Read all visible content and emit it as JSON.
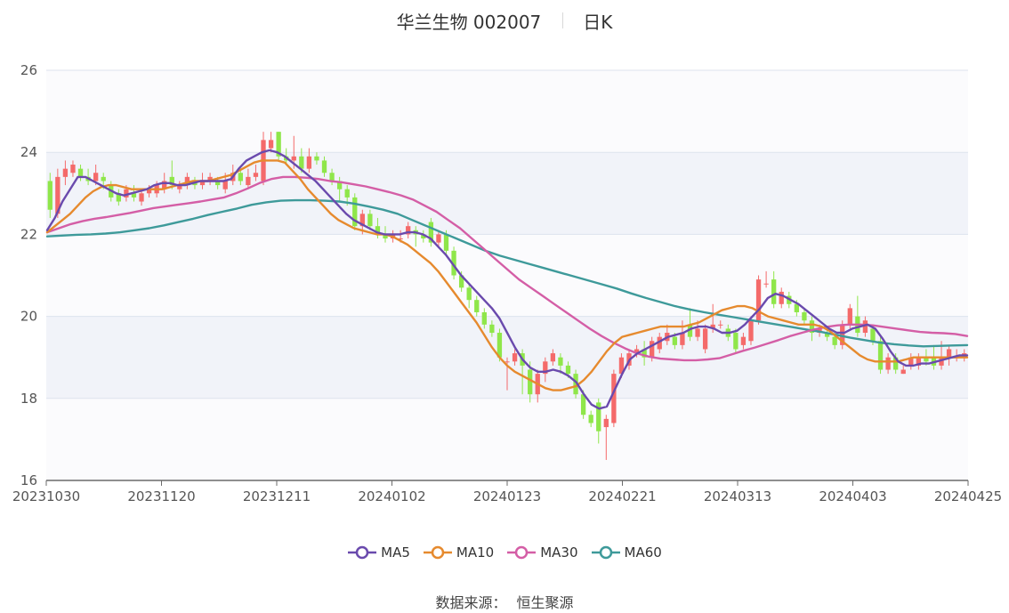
{
  "header": {
    "title": "华兰生物 002007",
    "period": "日K"
  },
  "legend": [
    {
      "label": "MA5",
      "color": "#6a4aad"
    },
    {
      "label": "MA10",
      "color": "#e68a2e"
    },
    {
      "label": "MA30",
      "color": "#d45ea6"
    },
    {
      "label": "MA60",
      "color": "#3e9a9a"
    }
  ],
  "footer": {
    "source_label": "数据来源：",
    "source_value": "恒生聚源"
  },
  "chart_data": {
    "type": "candlestick",
    "title": "华兰生物 002007",
    "ylim": [
      16,
      26
    ],
    "y_ticks": [
      "16",
      "18",
      "20",
      "22",
      "24",
      "26"
    ],
    "x_ticks": [
      "20231030",
      "20231120",
      "20231211",
      "20240102",
      "20240123",
      "20240221",
      "20240313",
      "20240403",
      "20240425"
    ],
    "colors": {
      "up": "#f46a6a",
      "down": "#8fe64a",
      "ma5": "#6a4aad",
      "ma10": "#e68a2e",
      "ma30": "#d45ea6",
      "ma60": "#3e9a9a"
    },
    "candles": [
      [
        23.3,
        22.6,
        23.5,
        22.4
      ],
      [
        22.5,
        23.4,
        23.6,
        22.4
      ],
      [
        23.4,
        23.6,
        23.8,
        23.2
      ],
      [
        23.5,
        23.7,
        23.8,
        23.4
      ],
      [
        23.6,
        23.4,
        23.7,
        23.3
      ],
      [
        23.4,
        23.3,
        23.6,
        23.2
      ],
      [
        23.3,
        23.5,
        23.7,
        23.2
      ],
      [
        23.4,
        23.3,
        23.5,
        23.1
      ],
      [
        23.2,
        22.9,
        23.3,
        22.8
      ],
      [
        23.0,
        22.8,
        23.1,
        22.7
      ],
      [
        22.9,
        23.1,
        23.2,
        22.8
      ],
      [
        23.0,
        22.9,
        23.2,
        22.8
      ],
      [
        22.8,
        23.0,
        23.1,
        22.7
      ],
      [
        23.0,
        23.1,
        23.2,
        22.9
      ],
      [
        23.0,
        23.2,
        23.3,
        22.9
      ],
      [
        23.1,
        23.3,
        23.5,
        23.0
      ],
      [
        23.4,
        23.2,
        23.8,
        23.1
      ],
      [
        23.1,
        23.2,
        23.3,
        23.0
      ],
      [
        23.2,
        23.4,
        23.5,
        23.1
      ],
      [
        23.3,
        23.2,
        23.4,
        23.1
      ],
      [
        23.2,
        23.3,
        23.5,
        23.1
      ],
      [
        23.3,
        23.4,
        23.5,
        23.2
      ],
      [
        23.3,
        23.2,
        23.4,
        23.1
      ],
      [
        23.1,
        23.3,
        23.5,
        23.0
      ],
      [
        23.3,
        23.5,
        23.7,
        23.2
      ],
      [
        23.5,
        23.3,
        23.6,
        23.2
      ],
      [
        23.2,
        23.4,
        23.6,
        23.1
      ],
      [
        23.4,
        23.5,
        23.7,
        23.3
      ],
      [
        23.3,
        24.3,
        24.5,
        23.2
      ],
      [
        24.1,
        24.3,
        24.5,
        24.0
      ],
      [
        24.5,
        23.9,
        24.5,
        23.8
      ],
      [
        23.9,
        23.8,
        24.1,
        23.7
      ],
      [
        23.8,
        23.9,
        24.4,
        23.6
      ],
      [
        23.9,
        23.6,
        24.1,
        23.5
      ],
      [
        23.6,
        23.9,
        24.1,
        23.5
      ],
      [
        23.9,
        23.8,
        24.0,
        23.7
      ],
      [
        23.8,
        23.5,
        23.9,
        23.4
      ],
      [
        23.5,
        23.3,
        23.6,
        23.2
      ],
      [
        23.3,
        23.1,
        23.4,
        22.8
      ],
      [
        23.1,
        22.9,
        23.2,
        22.7
      ],
      [
        22.9,
        22.2,
        23.0,
        22.1
      ],
      [
        22.2,
        22.5,
        22.6,
        22.0
      ],
      [
        22.5,
        22.2,
        22.6,
        22.1
      ],
      [
        22.2,
        22.0,
        22.4,
        21.9
      ],
      [
        22.0,
        21.9,
        22.2,
        21.8
      ],
      [
        21.9,
        22.0,
        22.1,
        21.8
      ],
      [
        21.9,
        21.9,
        22.1,
        21.8
      ],
      [
        22.0,
        22.2,
        22.3,
        21.9
      ],
      [
        22.1,
        22.0,
        22.2,
        21.7
      ],
      [
        22.0,
        21.9,
        22.1,
        21.8
      ],
      [
        22.3,
        21.8,
        22.4,
        21.7
      ],
      [
        21.8,
        22.0,
        22.1,
        21.7
      ],
      [
        22.0,
        21.6,
        22.1,
        21.5
      ],
      [
        21.6,
        21.0,
        21.7,
        20.9
      ],
      [
        21.0,
        20.7,
        21.1,
        20.6
      ],
      [
        20.7,
        20.4,
        20.8,
        20.2
      ],
      [
        20.4,
        20.1,
        20.5,
        20.0
      ],
      [
        20.1,
        19.8,
        20.2,
        19.7
      ],
      [
        19.8,
        19.6,
        19.9,
        19.5
      ],
      [
        19.6,
        19.0,
        19.7,
        18.9
      ],
      [
        18.9,
        18.9,
        19.0,
        18.2
      ],
      [
        18.9,
        19.1,
        19.2,
        18.8
      ],
      [
        19.1,
        18.8,
        19.2,
        18.1
      ],
      [
        18.7,
        18.1,
        18.9,
        17.9
      ],
      [
        18.1,
        18.6,
        18.7,
        17.9
      ],
      [
        18.6,
        18.9,
        19.0,
        18.4
      ],
      [
        18.9,
        19.1,
        19.2,
        18.8
      ],
      [
        19.0,
        18.8,
        19.1,
        18.6
      ],
      [
        18.8,
        18.6,
        18.9,
        18.5
      ],
      [
        18.6,
        18.1,
        18.7,
        18.0
      ],
      [
        18.1,
        17.6,
        18.2,
        17.5
      ],
      [
        17.6,
        17.4,
        17.7,
        17.3
      ],
      [
        17.9,
        17.2,
        18.0,
        16.9
      ],
      [
        17.3,
        17.5,
        17.6,
        16.5
      ],
      [
        17.4,
        18.6,
        18.7,
        17.3
      ],
      [
        18.6,
        19.0,
        19.1,
        18.5
      ],
      [
        18.8,
        19.1,
        19.2,
        18.7
      ],
      [
        19.1,
        19.2,
        19.3,
        19.0
      ],
      [
        19.2,
        19.0,
        19.4,
        18.8
      ],
      [
        19.0,
        19.4,
        19.5,
        18.9
      ],
      [
        19.2,
        19.5,
        19.6,
        19.1
      ],
      [
        19.4,
        19.6,
        19.8,
        19.3
      ],
      [
        19.5,
        19.3,
        19.6,
        19.2
      ],
      [
        19.3,
        19.6,
        19.9,
        19.2
      ],
      [
        19.8,
        19.5,
        20.2,
        19.4
      ],
      [
        19.5,
        19.7,
        19.9,
        19.4
      ],
      [
        19.2,
        19.7,
        19.8,
        19.1
      ],
      [
        19.7,
        19.8,
        20.3,
        19.6
      ],
      [
        19.8,
        19.8,
        19.9,
        19.7
      ],
      [
        19.7,
        19.5,
        19.8,
        19.4
      ],
      [
        19.6,
        19.2,
        19.7,
        19.1
      ],
      [
        19.3,
        19.5,
        19.6,
        19.2
      ],
      [
        19.4,
        19.9,
        20.0,
        19.3
      ],
      [
        19.9,
        20.9,
        21.0,
        19.8
      ],
      [
        20.8,
        20.8,
        21.1,
        20.7
      ],
      [
        20.9,
        20.3,
        21.1,
        20.2
      ],
      [
        20.3,
        20.6,
        20.7,
        20.2
      ],
      [
        20.5,
        20.3,
        20.6,
        20.2
      ],
      [
        20.3,
        20.1,
        20.4,
        20.0
      ],
      [
        20.1,
        19.9,
        20.2,
        19.8
      ],
      [
        19.9,
        19.6,
        20.0,
        19.4
      ],
      [
        19.6,
        19.7,
        19.8,
        19.5
      ],
      [
        19.6,
        19.5,
        19.7,
        19.4
      ],
      [
        19.5,
        19.3,
        19.6,
        19.2
      ],
      [
        19.3,
        19.8,
        19.9,
        19.2
      ],
      [
        19.8,
        20.2,
        20.3,
        19.7
      ],
      [
        20.0,
        19.6,
        20.5,
        19.5
      ],
      [
        19.6,
        19.9,
        20.0,
        19.5
      ],
      [
        19.7,
        19.4,
        19.8,
        19.3
      ],
      [
        19.4,
        18.7,
        19.5,
        18.6
      ],
      [
        18.7,
        19.0,
        19.1,
        18.6
      ],
      [
        19.0,
        18.7,
        19.1,
        18.6
      ],
      [
        18.6,
        18.7,
        18.8,
        18.6
      ],
      [
        18.8,
        19.0,
        19.1,
        18.7
      ],
      [
        18.8,
        19.0,
        19.1,
        18.7
      ],
      [
        19.0,
        18.9,
        19.2,
        18.8
      ],
      [
        19.0,
        18.8,
        19.3,
        18.7
      ],
      [
        18.8,
        19.0,
        19.4,
        18.7
      ],
      [
        19.0,
        19.2,
        19.3,
        18.8
      ],
      [
        19.0,
        19.0,
        19.2,
        18.9
      ],
      [
        19.0,
        19.1,
        19.2,
        18.9
      ]
    ],
    "ma5": [
      22.1,
      22.4,
      22.8,
      23.1,
      23.4,
      23.4,
      23.3,
      23.2,
      23.1,
      23.0,
      22.95,
      23.0,
      23.05,
      23.1,
      23.2,
      23.25,
      23.25,
      23.2,
      23.2,
      23.25,
      23.3,
      23.3,
      23.3,
      23.3,
      23.35,
      23.6,
      23.8,
      23.9,
      24.0,
      24.05,
      24.0,
      23.9,
      23.75,
      23.6,
      23.45,
      23.3,
      23.1,
      22.9,
      22.7,
      22.5,
      22.35,
      22.25,
      22.15,
      22.05,
      22.0,
      22.0,
      22.0,
      22.05,
      22.05,
      22.0,
      21.9,
      21.7,
      21.5,
      21.25,
      21.0,
      20.8,
      20.6,
      20.4,
      20.2,
      19.95,
      19.6,
      19.25,
      18.95,
      18.75,
      18.65,
      18.65,
      18.7,
      18.65,
      18.55,
      18.4,
      18.1,
      17.85,
      17.75,
      17.8,
      18.2,
      18.6,
      18.95,
      19.1,
      19.2,
      19.3,
      19.4,
      19.5,
      19.55,
      19.6,
      19.7,
      19.75,
      19.75,
      19.7,
      19.6,
      19.6,
      19.65,
      19.8,
      20.0,
      20.2,
      20.45,
      20.55,
      20.5,
      20.4,
      20.3,
      20.15,
      20.0,
      19.85,
      19.7,
      19.6,
      19.6,
      19.7,
      19.75,
      19.8,
      19.7,
      19.45,
      19.15,
      18.9,
      18.8,
      18.8,
      18.85,
      18.85,
      18.9,
      18.95,
      19.0,
      19.05,
      19.05
    ],
    "ma10": [
      22.05,
      22.2,
      22.35,
      22.5,
      22.7,
      22.9,
      23.05,
      23.15,
      23.2,
      23.2,
      23.15,
      23.1,
      23.1,
      23.1,
      23.1,
      23.1,
      23.15,
      23.2,
      23.25,
      23.3,
      23.3,
      23.3,
      23.35,
      23.4,
      23.45,
      23.55,
      23.65,
      23.75,
      23.8,
      23.8,
      23.8,
      23.75,
      23.55,
      23.35,
      23.1,
      22.9,
      22.7,
      22.5,
      22.35,
      22.25,
      22.15,
      22.1,
      22.05,
      22.0,
      22.0,
      21.95,
      21.85,
      21.75,
      21.6,
      21.45,
      21.3,
      21.1,
      20.85,
      20.6,
      20.35,
      20.1,
      19.85,
      19.55,
      19.25,
      19.0,
      18.8,
      18.65,
      18.55,
      18.45,
      18.35,
      18.25,
      18.2,
      18.2,
      18.25,
      18.3,
      18.45,
      18.65,
      18.9,
      19.15,
      19.35,
      19.5,
      19.55,
      19.6,
      19.65,
      19.7,
      19.75,
      19.75,
      19.75,
      19.75,
      19.8,
      19.85,
      19.95,
      20.05,
      20.15,
      20.2,
      20.25,
      20.25,
      20.2,
      20.1,
      20.0,
      19.95,
      19.9,
      19.85,
      19.8,
      19.8,
      19.8,
      19.75,
      19.65,
      19.5,
      19.35,
      19.2,
      19.05,
      18.95,
      18.9,
      18.9,
      18.9,
      18.9,
      18.95,
      19.0,
      19.0,
      19.0,
      19.0,
      19.0,
      19.0,
      19.0,
      19.0
    ],
    "ma30": [
      22.05,
      22.15,
      22.25,
      22.32,
      22.38,
      22.42,
      22.47,
      22.52,
      22.58,
      22.64,
      22.68,
      22.72,
      22.76,
      22.8,
      22.85,
      22.9,
      23.0,
      23.12,
      23.25,
      23.35,
      23.4,
      23.4,
      23.38,
      23.35,
      23.3,
      23.27,
      23.22,
      23.17,
      23.1,
      23.03,
      22.95,
      22.85,
      22.7,
      22.55,
      22.35,
      22.15,
      21.9,
      21.65,
      21.4,
      21.15,
      20.9,
      20.7,
      20.5,
      20.3,
      20.1,
      19.9,
      19.7,
      19.52,
      19.36,
      19.22,
      19.1,
      19.02,
      18.97,
      18.95,
      18.93,
      18.93,
      18.95,
      18.98,
      19.07,
      19.16,
      19.24,
      19.33,
      19.42,
      19.52,
      19.6,
      19.68,
      19.74,
      19.78,
      19.8,
      19.8,
      19.78,
      19.74,
      19.7,
      19.66,
      19.62,
      19.6,
      19.59,
      19.57,
      19.52
    ],
    "ma60": [
      21.95,
      21.97,
      21.99,
      22.0,
      22.02,
      22.05,
      22.1,
      22.15,
      22.22,
      22.3,
      22.38,
      22.47,
      22.55,
      22.63,
      22.72,
      22.78,
      22.82,
      22.83,
      22.83,
      22.82,
      22.8,
      22.75,
      22.68,
      22.6,
      22.5,
      22.35,
      22.2,
      22.05,
      21.9,
      21.75,
      21.6,
      21.48,
      21.38,
      21.28,
      21.18,
      21.08,
      20.98,
      20.88,
      20.78,
      20.68,
      20.56,
      20.45,
      20.35,
      20.25,
      20.17,
      20.1,
      20.04,
      19.98,
      19.92,
      19.86,
      19.8,
      19.74,
      19.68,
      19.62,
      19.55,
      19.48,
      19.42,
      19.36,
      19.32,
      19.29,
      19.27,
      19.28,
      19.29,
      19.3
    ]
  }
}
